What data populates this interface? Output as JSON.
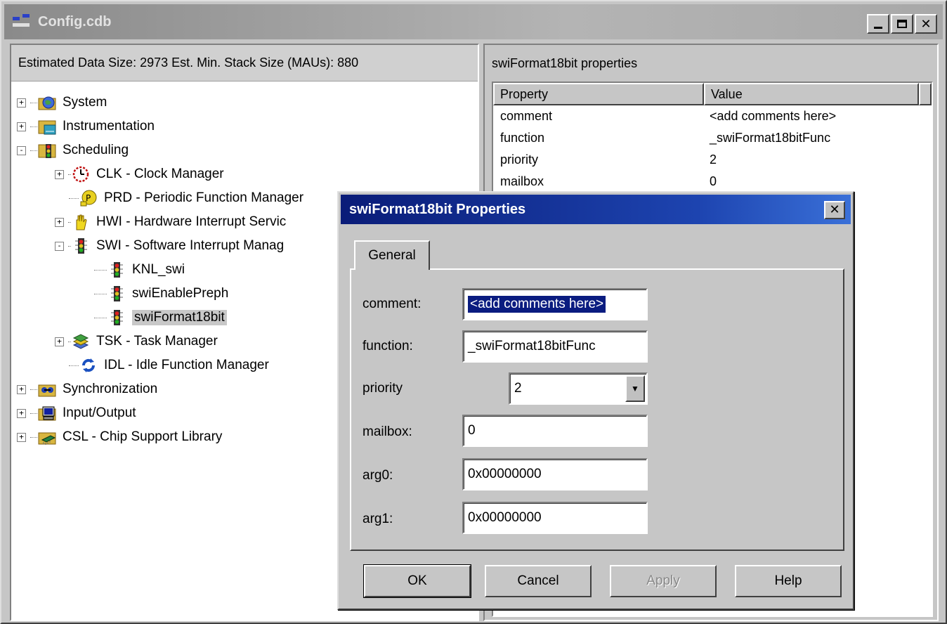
{
  "window": {
    "title": "Config.cdb"
  },
  "left": {
    "header": "Estimated Data Size: 2973   Est. Min. Stack Size (MAUs): 880",
    "tree": [
      {
        "label": "System",
        "icon": "system-globe-icon",
        "expander": "+"
      },
      {
        "label": "Instrumentation",
        "icon": "instrumentation-icon",
        "expander": "+"
      },
      {
        "label": "Scheduling",
        "icon": "traffic-light-icon",
        "expander": "-"
      },
      {
        "label": "CLK - Clock Manager",
        "icon": "clock-icon",
        "expander": "+"
      },
      {
        "label": "PRD - Periodic Function Manager",
        "icon": "periodic-icon",
        "expander": ""
      },
      {
        "label": "HWI - Hardware Interrupt Servic",
        "icon": "hand-icon",
        "expander": "+"
      },
      {
        "label": "SWI - Software Interrupt Manag",
        "icon": "traffic-light-icon",
        "expander": "-"
      },
      {
        "label": "KNL_swi",
        "icon": "traffic-light-icon",
        "expander": ""
      },
      {
        "label": "swiEnablePreph",
        "icon": "traffic-light-icon",
        "expander": ""
      },
      {
        "label": "swiFormat18bit",
        "icon": "traffic-light-icon",
        "expander": ""
      },
      {
        "label": "TSK - Task Manager",
        "icon": "task-stack-icon",
        "expander": "+"
      },
      {
        "label": "IDL - Idle Function Manager",
        "icon": "idle-cycle-icon",
        "expander": ""
      },
      {
        "label": "Synchronization",
        "icon": "synchronization-icon",
        "expander": "+"
      },
      {
        "label": "Input/Output",
        "icon": "monitor-icon",
        "expander": "+"
      },
      {
        "label": "CSL - Chip Support Library",
        "icon": "chip-icon",
        "expander": "+"
      }
    ]
  },
  "right": {
    "header": "swiFormat18bit properties",
    "columns": [
      "Property",
      "Value"
    ],
    "rows": [
      {
        "name": "comment",
        "value": "<add comments here>"
      },
      {
        "name": "function",
        "value": "_swiFormat18bitFunc"
      },
      {
        "name": "priority",
        "value": "2"
      },
      {
        "name": "mailbox",
        "value": "0"
      }
    ]
  },
  "dialog": {
    "title": "swiFormat18bit Properties",
    "tab": "General",
    "fields": {
      "comment": {
        "label": "comment:",
        "value": "<add comments here>"
      },
      "function": {
        "label": "function:",
        "value": "_swiFormat18bitFunc"
      },
      "priority": {
        "label": "priority",
        "value": "2"
      },
      "mailbox": {
        "label": "mailbox:",
        "value": "0"
      },
      "arg0": {
        "label": "arg0:",
        "value": "0x00000000"
      },
      "arg1": {
        "label": "arg1:",
        "value": "0x00000000"
      }
    },
    "buttons": {
      "ok": "OK",
      "cancel": "Cancel",
      "apply": "Apply",
      "help": "Help"
    }
  }
}
